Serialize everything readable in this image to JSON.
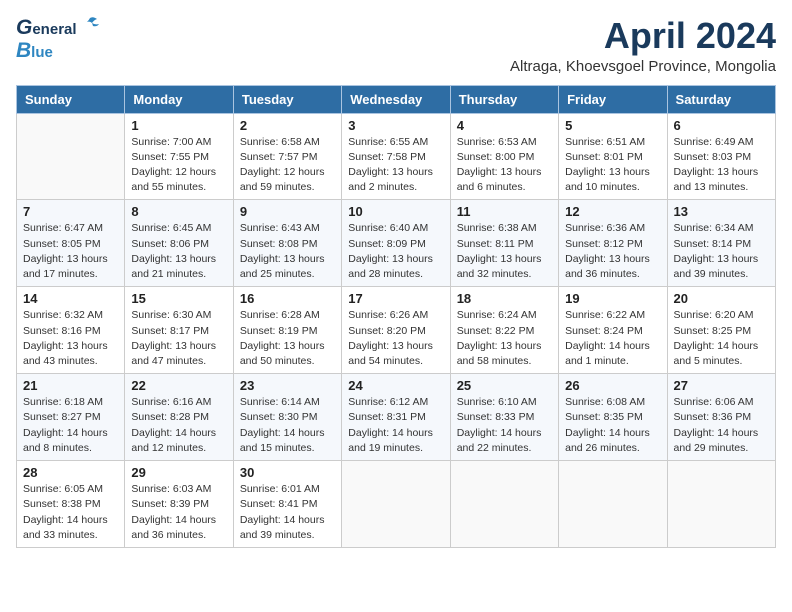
{
  "header": {
    "logo_line1": "General",
    "logo_line2": "Blue",
    "month": "April 2024",
    "location": "Altraga, Khoevsgoel Province, Mongolia"
  },
  "weekdays": [
    "Sunday",
    "Monday",
    "Tuesday",
    "Wednesday",
    "Thursday",
    "Friday",
    "Saturday"
  ],
  "weeks": [
    [
      {
        "day": "",
        "info": ""
      },
      {
        "day": "1",
        "info": "Sunrise: 7:00 AM\nSunset: 7:55 PM\nDaylight: 12 hours\nand 55 minutes."
      },
      {
        "day": "2",
        "info": "Sunrise: 6:58 AM\nSunset: 7:57 PM\nDaylight: 12 hours\nand 59 minutes."
      },
      {
        "day": "3",
        "info": "Sunrise: 6:55 AM\nSunset: 7:58 PM\nDaylight: 13 hours\nand 2 minutes."
      },
      {
        "day": "4",
        "info": "Sunrise: 6:53 AM\nSunset: 8:00 PM\nDaylight: 13 hours\nand 6 minutes."
      },
      {
        "day": "5",
        "info": "Sunrise: 6:51 AM\nSunset: 8:01 PM\nDaylight: 13 hours\nand 10 minutes."
      },
      {
        "day": "6",
        "info": "Sunrise: 6:49 AM\nSunset: 8:03 PM\nDaylight: 13 hours\nand 13 minutes."
      }
    ],
    [
      {
        "day": "7",
        "info": "Sunrise: 6:47 AM\nSunset: 8:05 PM\nDaylight: 13 hours\nand 17 minutes."
      },
      {
        "day": "8",
        "info": "Sunrise: 6:45 AM\nSunset: 8:06 PM\nDaylight: 13 hours\nand 21 minutes."
      },
      {
        "day": "9",
        "info": "Sunrise: 6:43 AM\nSunset: 8:08 PM\nDaylight: 13 hours\nand 25 minutes."
      },
      {
        "day": "10",
        "info": "Sunrise: 6:40 AM\nSunset: 8:09 PM\nDaylight: 13 hours\nand 28 minutes."
      },
      {
        "day": "11",
        "info": "Sunrise: 6:38 AM\nSunset: 8:11 PM\nDaylight: 13 hours\nand 32 minutes."
      },
      {
        "day": "12",
        "info": "Sunrise: 6:36 AM\nSunset: 8:12 PM\nDaylight: 13 hours\nand 36 minutes."
      },
      {
        "day": "13",
        "info": "Sunrise: 6:34 AM\nSunset: 8:14 PM\nDaylight: 13 hours\nand 39 minutes."
      }
    ],
    [
      {
        "day": "14",
        "info": "Sunrise: 6:32 AM\nSunset: 8:16 PM\nDaylight: 13 hours\nand 43 minutes."
      },
      {
        "day": "15",
        "info": "Sunrise: 6:30 AM\nSunset: 8:17 PM\nDaylight: 13 hours\nand 47 minutes."
      },
      {
        "day": "16",
        "info": "Sunrise: 6:28 AM\nSunset: 8:19 PM\nDaylight: 13 hours\nand 50 minutes."
      },
      {
        "day": "17",
        "info": "Sunrise: 6:26 AM\nSunset: 8:20 PM\nDaylight: 13 hours\nand 54 minutes."
      },
      {
        "day": "18",
        "info": "Sunrise: 6:24 AM\nSunset: 8:22 PM\nDaylight: 13 hours\nand 58 minutes."
      },
      {
        "day": "19",
        "info": "Sunrise: 6:22 AM\nSunset: 8:24 PM\nDaylight: 14 hours\nand 1 minute."
      },
      {
        "day": "20",
        "info": "Sunrise: 6:20 AM\nSunset: 8:25 PM\nDaylight: 14 hours\nand 5 minutes."
      }
    ],
    [
      {
        "day": "21",
        "info": "Sunrise: 6:18 AM\nSunset: 8:27 PM\nDaylight: 14 hours\nand 8 minutes."
      },
      {
        "day": "22",
        "info": "Sunrise: 6:16 AM\nSunset: 8:28 PM\nDaylight: 14 hours\nand 12 minutes."
      },
      {
        "day": "23",
        "info": "Sunrise: 6:14 AM\nSunset: 8:30 PM\nDaylight: 14 hours\nand 15 minutes."
      },
      {
        "day": "24",
        "info": "Sunrise: 6:12 AM\nSunset: 8:31 PM\nDaylight: 14 hours\nand 19 minutes."
      },
      {
        "day": "25",
        "info": "Sunrise: 6:10 AM\nSunset: 8:33 PM\nDaylight: 14 hours\nand 22 minutes."
      },
      {
        "day": "26",
        "info": "Sunrise: 6:08 AM\nSunset: 8:35 PM\nDaylight: 14 hours\nand 26 minutes."
      },
      {
        "day": "27",
        "info": "Sunrise: 6:06 AM\nSunset: 8:36 PM\nDaylight: 14 hours\nand 29 minutes."
      }
    ],
    [
      {
        "day": "28",
        "info": "Sunrise: 6:05 AM\nSunset: 8:38 PM\nDaylight: 14 hours\nand 33 minutes."
      },
      {
        "day": "29",
        "info": "Sunrise: 6:03 AM\nSunset: 8:39 PM\nDaylight: 14 hours\nand 36 minutes."
      },
      {
        "day": "30",
        "info": "Sunrise: 6:01 AM\nSunset: 8:41 PM\nDaylight: 14 hours\nand 39 minutes."
      },
      {
        "day": "",
        "info": ""
      },
      {
        "day": "",
        "info": ""
      },
      {
        "day": "",
        "info": ""
      },
      {
        "day": "",
        "info": ""
      }
    ]
  ]
}
